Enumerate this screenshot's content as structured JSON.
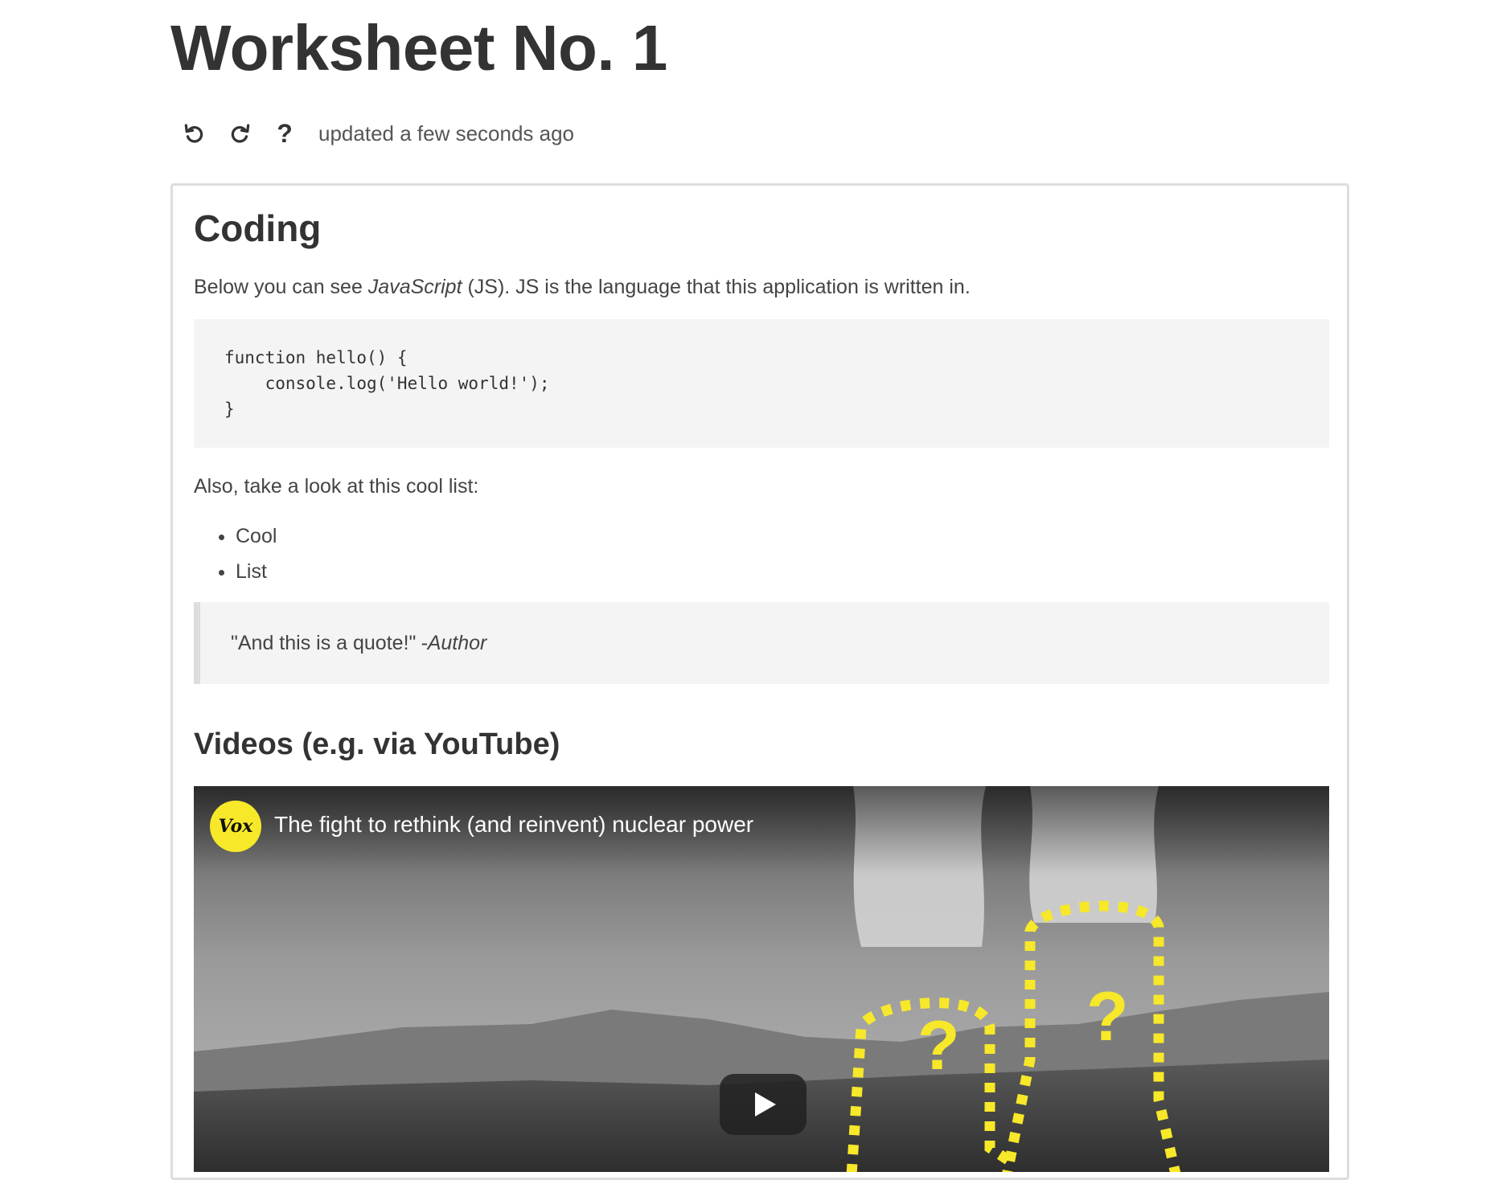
{
  "page": {
    "title": "Worksheet No. 1"
  },
  "toolbar": {
    "undo_icon": "undo-icon",
    "redo_icon": "redo-icon",
    "help_label": "?",
    "updated_text": "updated a few seconds ago"
  },
  "content": {
    "heading": "Coding",
    "intro_prefix": "Below you can see ",
    "intro_emphasis": "JavaScript",
    "intro_suffix": " (JS). JS is the language that this application is written in.",
    "code": "function hello() {\n    console.log('Hello world!');\n}",
    "list_intro": "Also, take a look at this cool list:",
    "list_items": [
      "Cool",
      "List"
    ],
    "quote_text": "\"And this is a quote!\" ",
    "quote_author": "-Author",
    "videos_heading": "Videos (e.g. via YouTube)"
  },
  "video": {
    "channel_logo_text": "Vox",
    "title": "The fight to rethink (and reinvent) nuclear power",
    "question_mark_left": "?",
    "question_mark_right": "?",
    "accent_color": "#f7e829",
    "play_icon": "play-icon"
  }
}
